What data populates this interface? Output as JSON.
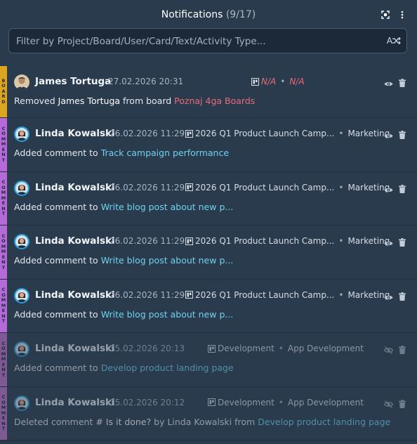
{
  "header": {
    "title": "Notifications",
    "count": "(9/17)",
    "icons": [
      "fullscreen-icon",
      "more-vertical-icon"
    ]
  },
  "search": {
    "placeholder": "Filter by Project/Board/User/Card/Text/Activity Type...",
    "sort_label": "A"
  },
  "notifications": [
    {
      "type_letters": [
        "B",
        "O",
        "A",
        "R",
        "D"
      ],
      "user": "James Tortuga",
      "date": "27.02.2026 20:31",
      "project": "N/A",
      "board": "N/A",
      "sep": "•",
      "body_prefix": "Removed ",
      "body_user": "James Tortuga",
      "body_mid": " from board ",
      "body_link": "Poznaj 4ga Boards"
    },
    {
      "type_letters": [
        "C",
        "O",
        "M",
        "M",
        "E",
        "N",
        "T"
      ],
      "user": "Linda Kowalski",
      "date": "26.02.2026 11:29",
      "project": "2026 Q1 Product Launch Camp...",
      "board": "Marketing",
      "sep": "•",
      "body_prefix": "Added comment to ",
      "body_link": "Track campaign performance"
    },
    {
      "type_letters": [
        "C",
        "O",
        "M",
        "M",
        "E",
        "N",
        "T"
      ],
      "user": "Linda Kowalski",
      "date": "26.02.2026 11:29",
      "project": "2026 Q1 Product Launch Camp...",
      "board": "Marketing",
      "sep": "•",
      "body_prefix": "Added comment to ",
      "body_link": "Write blog post about new p..."
    },
    {
      "type_letters": [
        "C",
        "O",
        "M",
        "M",
        "E",
        "N",
        "T"
      ],
      "user": "Linda Kowalski",
      "date": "26.02.2026 11:29",
      "project": "2026 Q1 Product Launch Camp...",
      "board": "Marketing",
      "sep": "•",
      "body_prefix": "Added comment to ",
      "body_link": "Write blog post about new p..."
    },
    {
      "type_letters": [
        "C",
        "O",
        "M",
        "M",
        "E",
        "N",
        "T"
      ],
      "user": "Linda Kowalski",
      "date": "26.02.2026 11:29",
      "project": "2026 Q1 Product Launch Camp...",
      "board": "Marketing",
      "sep": "•",
      "body_prefix": "Added comment to ",
      "body_link": "Write blog post about new p..."
    },
    {
      "type_letters": [
        "C",
        "O",
        "M",
        "M",
        "E",
        "N",
        "T"
      ],
      "user": "Linda Kowalski",
      "date": "15.02.2026 20:13",
      "project": "Development",
      "board": "App Development",
      "sep": "•",
      "body_prefix": "Added comment to ",
      "body_link": "Develop product landing page"
    },
    {
      "type_letters": [
        "C",
        "O",
        "M",
        "M",
        "E",
        "N",
        "T"
      ],
      "user": "Linda Kowalski",
      "date": "15.02.2026 20:12",
      "project": "Development",
      "board": "App Development",
      "sep": "•",
      "body_prefix": "Deleted comment ",
      "body_hash": "#",
      "body_quote": " Is it done?",
      "body_by": " by ",
      "body_user": "Linda Kowalski",
      "body_from": " from ",
      "body_link": "Develop product landing page"
    }
  ],
  "colors": {
    "background": "#2b3b4e",
    "board_tag": "#dba520",
    "comment_tag": "#b46ad7",
    "link": "#6fd2ee",
    "na": "#ea6a78"
  }
}
